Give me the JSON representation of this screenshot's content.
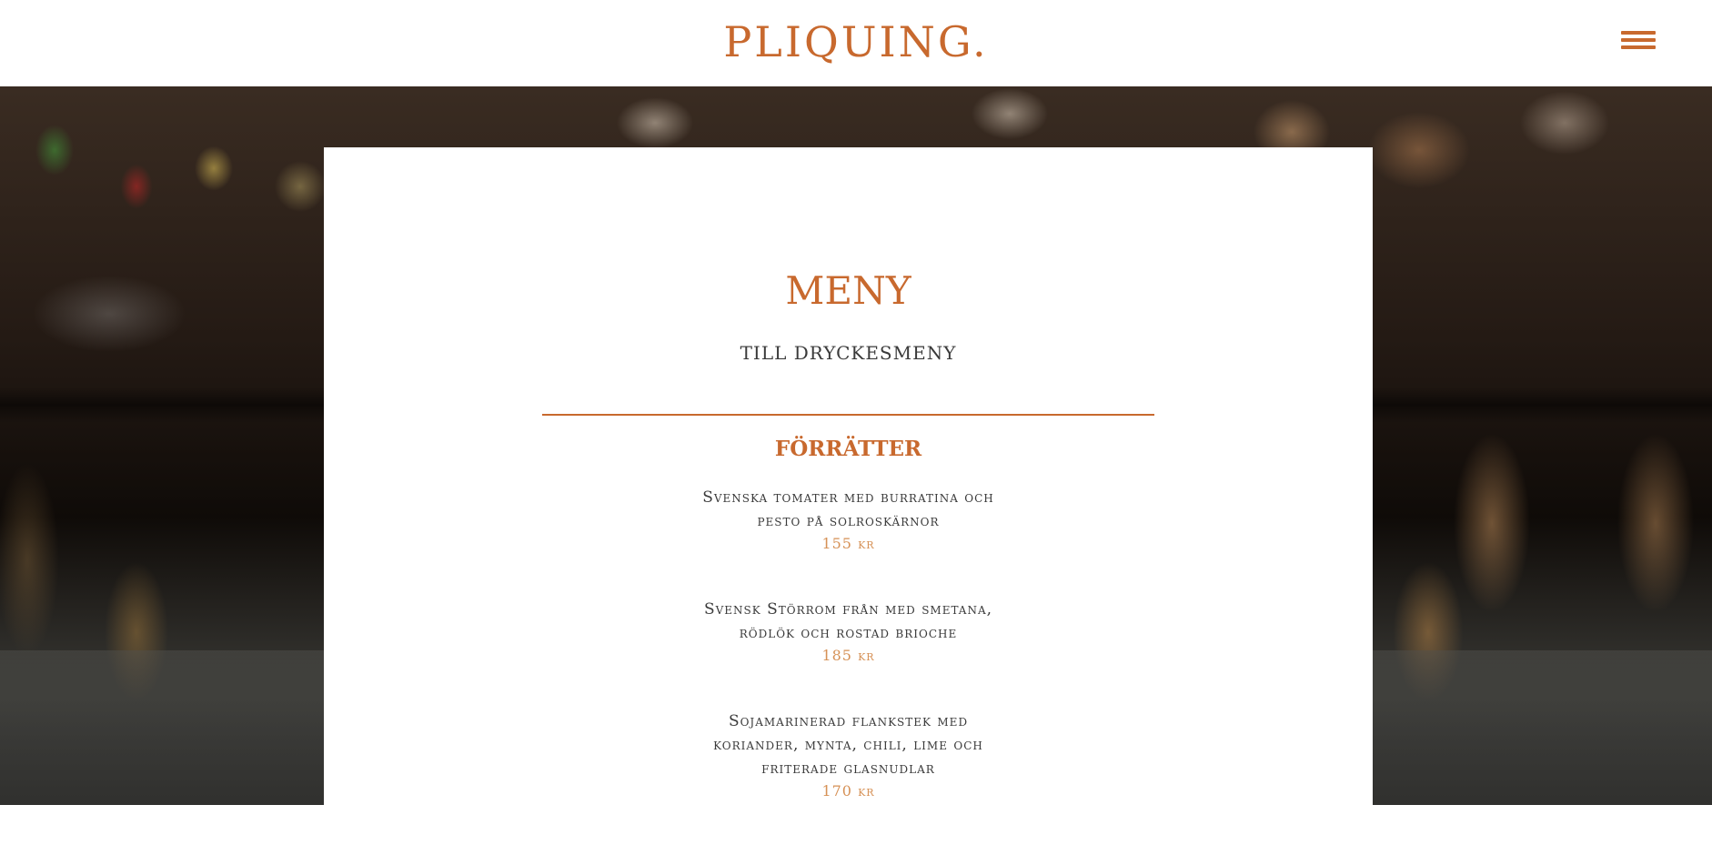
{
  "header": {
    "logo": "PLIQUING."
  },
  "colors": {
    "accent": "#c8692e",
    "price": "#d69156",
    "text": "#3a3a3a"
  },
  "icons": {
    "menu": "hamburger-icon"
  },
  "menu": {
    "title": "MENY",
    "drinks_link": "TILL DRYCKESMENY",
    "section_title": "FÖRRÄTTER",
    "dishes": [
      {
        "name": "Svenska tomater med burratina och pesto på solroskärnor",
        "price": "155 kr"
      },
      {
        "name": "Svensk Störrom från med smetana, rödlök och rostad brioche",
        "price": "185 kr"
      },
      {
        "name": "Sojamarinerad flankstek med koriander, mynta, chili, lime och friterade glasnudlar",
        "price": "170 kr"
      }
    ]
  }
}
